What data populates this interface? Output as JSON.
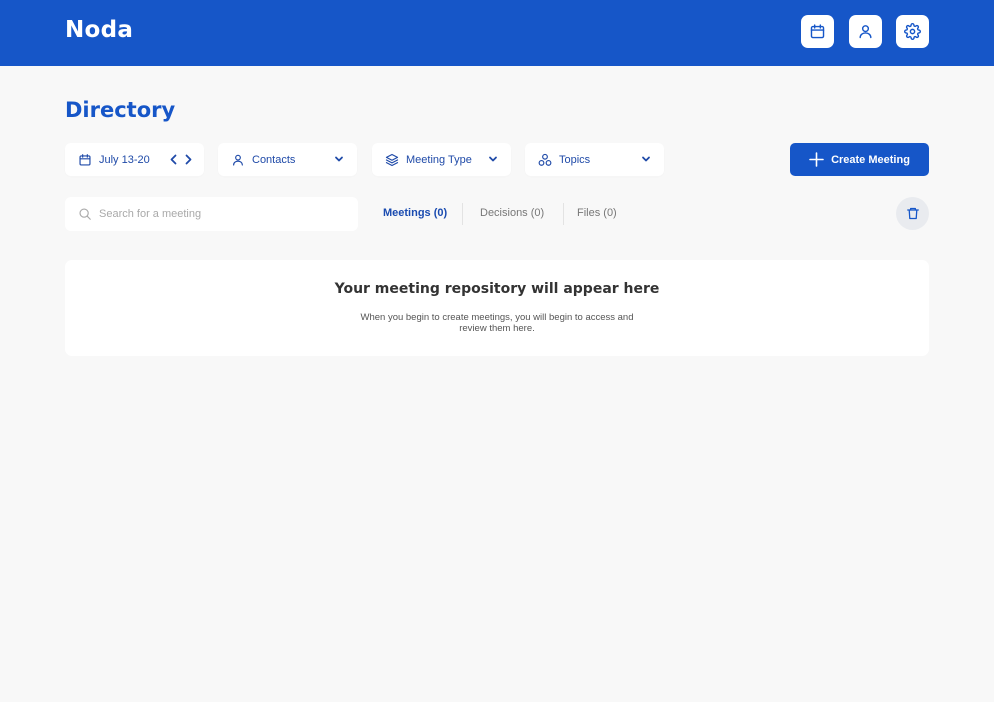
{
  "header": {
    "logo": "Noda",
    "buttons": [
      {
        "name": "calendar",
        "icon": "calendar-icon"
      },
      {
        "name": "profile",
        "icon": "user-icon"
      },
      {
        "name": "settings",
        "icon": "gear-icon"
      }
    ]
  },
  "page": {
    "title": "Directory"
  },
  "filters": {
    "date": {
      "label": "July 13-20",
      "icon": "calendar-icon"
    },
    "contacts": {
      "label": "Contacts",
      "icon": "user-icon"
    },
    "meeting_type": {
      "label": "Meeting Type",
      "icon": "layers-icon"
    },
    "topics": {
      "label": "Topics",
      "icon": "topics-icon"
    }
  },
  "actions": {
    "create_label": "Create Meeting"
  },
  "search": {
    "placeholder": "Search for a meeting",
    "value": ""
  },
  "tabs": [
    {
      "label": "Meetings (0)",
      "active": true
    },
    {
      "label": "Decisions (0)",
      "active": false
    },
    {
      "label": "Files (0)",
      "active": false
    }
  ],
  "empty_state": {
    "title": "Your meeting repository will appear here",
    "description": "When you begin to create meetings, you will begin to access and review them here."
  },
  "colors": {
    "brand": "#1656c8",
    "background": "#f8f8f8",
    "card": "#ffffff"
  }
}
